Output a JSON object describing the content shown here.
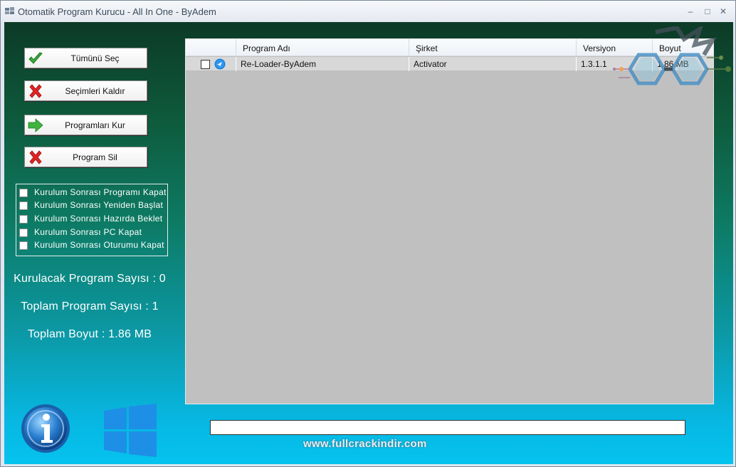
{
  "window": {
    "title": "Otomatik Program Kurucu - All In One - ByAdem",
    "minimize_glyph": "–",
    "maximize_glyph": "□",
    "close_glyph": "✕"
  },
  "actions": [
    {
      "label": "Tümünü Seç",
      "icon": "checkmark-icon"
    },
    {
      "label": "Seçimleri Kaldır",
      "icon": "red-x-icon"
    },
    {
      "label": "Programları Kur",
      "icon": "green-arrow-icon"
    },
    {
      "label": "Program Sil",
      "icon": "red-x-icon"
    }
  ],
  "options": [
    {
      "label": "Kurulum Sonrası Programı Kapat",
      "checked": false
    },
    {
      "label": "Kurulum Sonrası Yeniden Başlat",
      "checked": false
    },
    {
      "label": "Kurulum Sonrası Hazırda Beklet",
      "checked": false
    },
    {
      "label": "Kurulum Sonrası PC Kapat",
      "checked": false
    },
    {
      "label": "Kurulum Sonrası Oturumu Kapat",
      "checked": false
    }
  ],
  "stats": {
    "to_install": "Kurulacak Program Sayısı : 0",
    "total_programs": "Toplam Program Sayısı : 1",
    "total_size": "Toplam Boyut : 1.86 MB"
  },
  "table": {
    "columns": [
      "Program Adı",
      "Şirket",
      "Versiyon",
      "Boyut"
    ],
    "rows": [
      {
        "checked": false,
        "name": "Re-Loader-ByAdem",
        "company": "Activator",
        "version": "1.3.1.1",
        "size": "1.86 MB"
      }
    ]
  },
  "progress": {
    "value": 0
  },
  "watermark": "www.fullcrackindir.com",
  "colors": {
    "accent_green": "#2e9e2e",
    "accent_red": "#d62020",
    "windows_blue": "#1e90e8"
  }
}
